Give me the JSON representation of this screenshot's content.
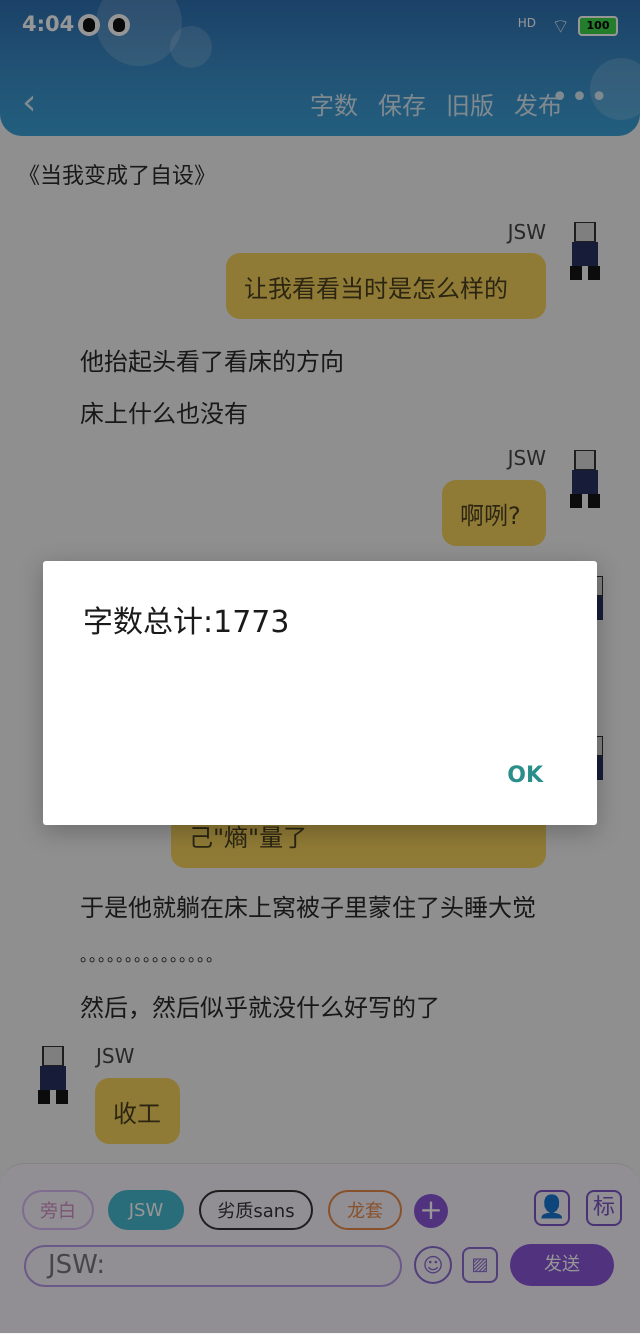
{
  "status": {
    "time": "4:04",
    "signal": "HD",
    "battery": "100"
  },
  "header": {
    "back": "‹",
    "actions": [
      "字数",
      "保存",
      "旧版",
      "发布"
    ],
    "more": "•••"
  },
  "content": {
    "book_title": "《当我变成了自设》",
    "messages": [
      {
        "name": "JSW",
        "text": "让我看看当时是怎么样的"
      },
      {
        "narration": "他抬起头看了看床的方向"
      },
      {
        "narration": "床上什么也没有"
      },
      {
        "name": "JSW",
        "text": "啊咧?"
      },
      {
        "partial": "己\"熵\"量了"
      },
      {
        "narration": "于是他就躺在床上窝被子里蒙住了头睡大觉"
      },
      {
        "narration": "。。。。。。。。。。。。。。。"
      },
      {
        "narration": "然后，然后似乎就没什么好写的了"
      },
      {
        "name": "JSW",
        "text": "收工"
      }
    ]
  },
  "dialog": {
    "title": "字数总计:1773",
    "ok": "OK"
  },
  "bottom": {
    "chips": [
      "旁白",
      "JSW",
      "劣质sans",
      "龙套"
    ],
    "plus": "+",
    "person_icon": "👤",
    "tag_label": "标",
    "input_value": "JSW:",
    "emoji": "☺",
    "image": "▨",
    "send": "发送"
  }
}
